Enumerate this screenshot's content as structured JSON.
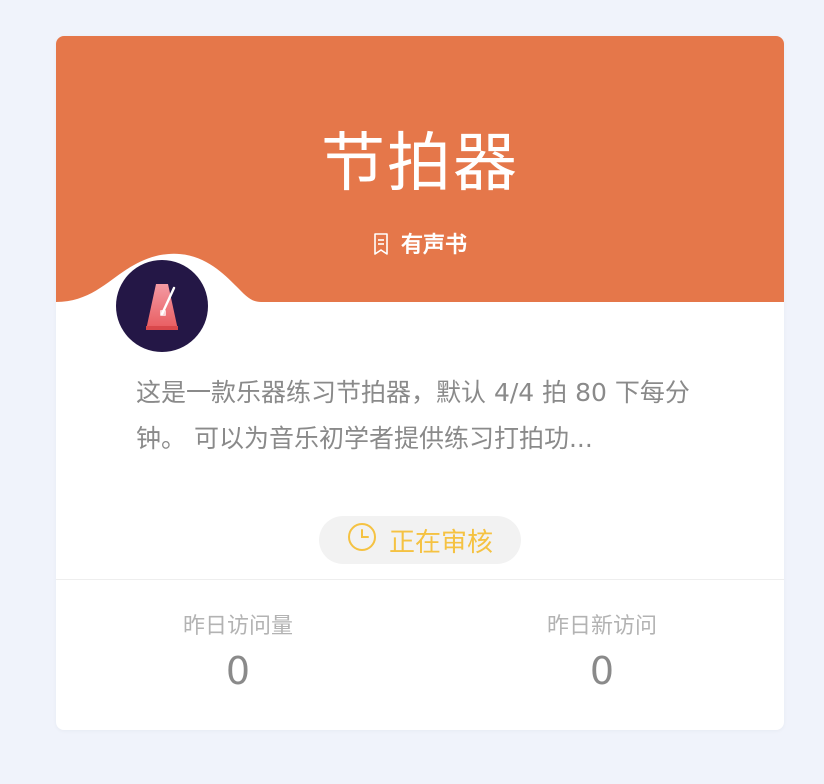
{
  "app": {
    "title": "节拍器",
    "category": "有声书",
    "description": "这是一款乐器练习节拍器，默认 4/4 拍 80 下每分钟。 可以为音乐初学者提供练习打拍功...",
    "status": "正在审核"
  },
  "stats": [
    {
      "label": "昨日访问量",
      "value": "0"
    },
    {
      "label": "昨日新访问",
      "value": "0"
    }
  ],
  "icons": {
    "category": "book-icon",
    "status": "clock-icon",
    "avatar": "metronome-icon"
  },
  "colors": {
    "banner": "#e5774a",
    "status_text": "#f5c242",
    "avatar_bg": "#241746"
  }
}
